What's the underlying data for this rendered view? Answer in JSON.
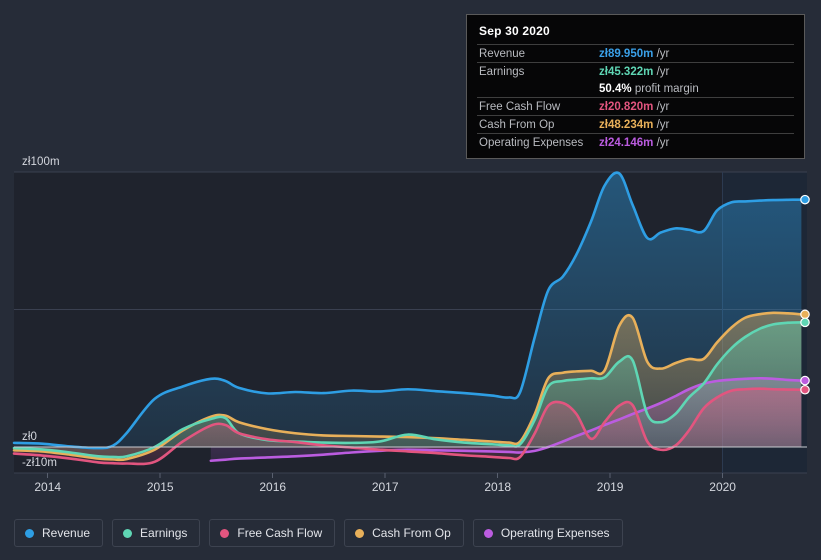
{
  "theme": {
    "page_bg": "#262c38",
    "plot_bg": "#1f232d",
    "plot_bg_forecast": "#1b2433",
    "grid": "#3a4050",
    "zero_line": "#c9ccd2",
    "axis_text": "#d4d7de"
  },
  "tooltip": {
    "date": "Sep 30 2020",
    "rows": [
      {
        "label": "Revenue",
        "value": "zł89.950m",
        "unit": "/yr",
        "color": "#3aa0e8",
        "sub": false
      },
      {
        "label": "Earnings",
        "value": "zł45.322m",
        "unit": "/yr",
        "color": "#5fd6b4",
        "sub": false
      },
      {
        "label": "",
        "value": "50.4%",
        "unit": "profit margin",
        "color": "#ffffff",
        "sub": true
      },
      {
        "label": "Free Cash Flow",
        "value": "zł20.820m",
        "unit": "/yr",
        "color": "#e2557f",
        "sub": false
      },
      {
        "label": "Cash From Op",
        "value": "zł48.234m",
        "unit": "/yr",
        "color": "#e8b05a",
        "sub": false
      },
      {
        "label": "Operating Expenses",
        "value": "zł24.146m",
        "unit": "/yr",
        "color": "#bb5ce0",
        "sub": false
      }
    ]
  },
  "legend": {
    "items": [
      {
        "label": "Revenue",
        "color": "#2e9ee4"
      },
      {
        "label": "Earnings",
        "color": "#5fd6b4"
      },
      {
        "label": "Free Cash Flow",
        "color": "#e2557f"
      },
      {
        "label": "Cash From Op",
        "color": "#e8b05a"
      },
      {
        "label": "Operating Expenses",
        "color": "#bb5ce0"
      }
    ]
  },
  "chart_data": {
    "type": "area",
    "title": "",
    "xlabel": "",
    "ylabel": "",
    "currency": "zł",
    "units": "m",
    "grid": true,
    "legend_position": "bottom",
    "y_ticks": [
      {
        "label": "zł100m",
        "value": 100
      },
      {
        "label": "",
        "value": 50
      },
      {
        "label": "zł0",
        "value": 0
      },
      {
        "label": "-zł10m",
        "value": -10
      }
    ],
    "ylim": [
      -10,
      108
    ],
    "x_ticks": [
      {
        "label": "2014",
        "value": 2014
      },
      {
        "label": "2015",
        "value": 2015
      },
      {
        "label": "2016",
        "value": 2016
      },
      {
        "label": "2017",
        "value": 2017
      },
      {
        "label": "2018",
        "value": 2018
      },
      {
        "label": "2019",
        "value": 2019
      },
      {
        "label": "2020",
        "value": 2020
      }
    ],
    "xlim": [
      2013.7,
      2020.75
    ],
    "forecast_start": 2020.0,
    "x": [
      2013.7,
      2013.95,
      2014.2,
      2014.45,
      2014.58,
      2014.7,
      2014.95,
      2015.2,
      2015.45,
      2015.58,
      2015.7,
      2015.95,
      2016.2,
      2016.45,
      2016.7,
      2016.95,
      2017.2,
      2017.45,
      2017.7,
      2017.95,
      2018.1,
      2018.2,
      2018.33,
      2018.45,
      2018.58,
      2018.7,
      2018.83,
      2018.95,
      2019.08,
      2019.2,
      2019.33,
      2019.45,
      2019.58,
      2019.7,
      2019.83,
      2019.95,
      2020.08,
      2020.2,
      2020.33,
      2020.45,
      2020.58,
      2020.7
    ],
    "series": [
      {
        "name": "Revenue",
        "color": "#2e9ee4",
        "end_value": 89.95,
        "values": [
          1.5,
          1.2,
          0.2,
          -0.4,
          0.5,
          5.0,
          17.5,
          22.0,
          24.8,
          24.0,
          21.5,
          19.5,
          20.0,
          19.6,
          20.5,
          20.2,
          21.0,
          20.3,
          19.6,
          18.7,
          18.0,
          20.0,
          40.0,
          57.0,
          62.0,
          70.0,
          82.0,
          95.0,
          99.5,
          88.0,
          76.0,
          78.0,
          79.5,
          79.0,
          78.5,
          86.0,
          89.0,
          89.3,
          89.6,
          89.8,
          89.9,
          89.95
        ]
      },
      {
        "name": "Cash From Op",
        "color": "#e8b05a",
        "end_value": 48.234,
        "values": [
          -1.2,
          -1.6,
          -2.8,
          -4.2,
          -4.5,
          -4.4,
          -1.0,
          6.0,
          11.0,
          11.4,
          9.0,
          6.5,
          5.0,
          4.2,
          4.0,
          3.8,
          3.6,
          3.2,
          2.6,
          2.0,
          1.6,
          2.0,
          12.0,
          25.0,
          27.0,
          27.5,
          27.7,
          27.8,
          44.0,
          47.0,
          31.0,
          28.5,
          30.5,
          32.0,
          32.0,
          38.0,
          43.5,
          47.0,
          48.3,
          48.8,
          48.6,
          48.234
        ]
      },
      {
        "name": "Earnings",
        "color": "#5fd6b4",
        "end_value": 45.322,
        "values": [
          -0.4,
          -0.9,
          -2.0,
          -3.4,
          -3.6,
          -3.4,
          0.0,
          6.5,
          10.2,
          10.5,
          5.0,
          2.5,
          2.0,
          1.6,
          1.5,
          2.0,
          4.5,
          2.8,
          1.6,
          1.0,
          0.6,
          1.0,
          10.0,
          22.0,
          24.0,
          24.5,
          25.0,
          25.3,
          31.0,
          31.5,
          12.0,
          9.0,
          12.0,
          18.0,
          23.0,
          30.0,
          36.0,
          40.0,
          43.0,
          44.6,
          45.2,
          45.322
        ]
      },
      {
        "name": "Free Cash Flow",
        "color": "#e2557f",
        "end_value": 20.82,
        "values": [
          -2.4,
          -3.1,
          -4.2,
          -5.6,
          -5.9,
          -6.0,
          -5.4,
          2.0,
          7.8,
          8.0,
          5.0,
          2.8,
          1.8,
          0.6,
          -0.2,
          -1.0,
          -1.6,
          -2.2,
          -3.0,
          -3.6,
          -4.0,
          -3.6,
          5.0,
          15.0,
          16.0,
          12.0,
          3.0,
          9.0,
          15.0,
          15.2,
          2.0,
          -1.0,
          0.5,
          6.0,
          14.0,
          18.0,
          20.5,
          21.0,
          21.2,
          21.0,
          20.9,
          20.82
        ]
      },
      {
        "name": "Operating Expenses",
        "color": "#bb5ce0",
        "end_value": 24.146,
        "values": [
          null,
          null,
          null,
          null,
          null,
          null,
          null,
          null,
          -5.0,
          -4.6,
          -4.2,
          -3.8,
          -3.4,
          -2.8,
          -2.0,
          -1.4,
          -1.0,
          -1.2,
          -1.4,
          -1.6,
          -1.8,
          -2.0,
          -1.4,
          0.0,
          2.0,
          4.0,
          6.0,
          8.0,
          10.0,
          12.0,
          14.0,
          16.0,
          18.5,
          21.0,
          23.0,
          24.0,
          24.5,
          24.8,
          25.0,
          24.8,
          24.4,
          24.146
        ]
      }
    ]
  }
}
